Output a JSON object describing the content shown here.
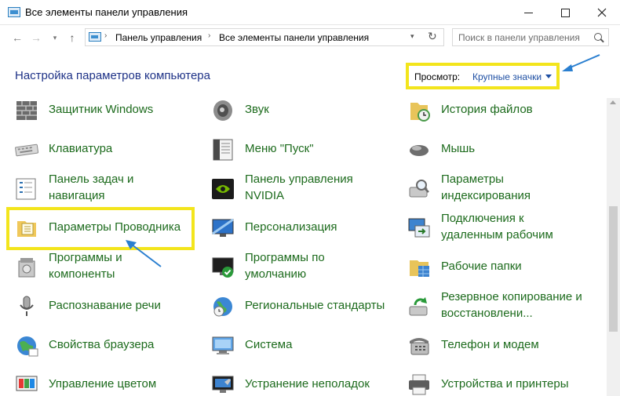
{
  "window": {
    "title": "Все элементы панели управления",
    "minimize": "—",
    "maximize": "☐",
    "close": "✕"
  },
  "nav": {
    "back": "←",
    "forward": "→",
    "recent": "▾",
    "up": "↑",
    "breadcrumbs": [
      "Панель управления",
      "Все элементы панели управления"
    ],
    "separator": "›",
    "dropdown": "▾",
    "refresh": "↻",
    "search_placeholder": "Поиск в панели управления"
  },
  "header": {
    "title": "Настройка параметров компьютера",
    "view_label": "Просмотр:",
    "view_value": "Крупные значки"
  },
  "items": [
    {
      "label": "Защитник Windows",
      "icon": "defender-wall-icon"
    },
    {
      "label": "Звук",
      "icon": "speaker-icon"
    },
    {
      "label": "История файлов",
      "icon": "file-history-icon"
    },
    {
      "label": "Клавиатура",
      "icon": "keyboard-icon"
    },
    {
      "label": "Меню \"Пуск\"",
      "icon": "start-menu-icon"
    },
    {
      "label": "Мышь",
      "icon": "mouse-icon"
    },
    {
      "label": "Панель задач и\nнавигация",
      "icon": "taskbar-icon"
    },
    {
      "label": "Панель управления\nNVIDIA",
      "icon": "nvidia-icon"
    },
    {
      "label": "Параметры\nиндексирования",
      "icon": "indexing-icon"
    },
    {
      "label": "Параметры Проводника",
      "icon": "explorer-options-icon"
    },
    {
      "label": "Персонализация",
      "icon": "personalization-icon"
    },
    {
      "label": "Подключения к\nудаленным рабочим",
      "icon": "remote-desktop-icon"
    },
    {
      "label": "Программы и\nкомпоненты",
      "icon": "programs-icon"
    },
    {
      "label": "Программы по\nумолчанию",
      "icon": "default-programs-icon"
    },
    {
      "label": "Рабочие папки",
      "icon": "work-folders-icon"
    },
    {
      "label": "Распознавание речи",
      "icon": "microphone-icon"
    },
    {
      "label": "Региональные стандарты",
      "icon": "globe-clock-icon"
    },
    {
      "label": "Резервное копирование и\nвосстановлени...",
      "icon": "backup-icon"
    },
    {
      "label": "Свойства браузера",
      "icon": "browser-globe-icon"
    },
    {
      "label": "Система",
      "icon": "system-monitor-icon"
    },
    {
      "label": "Телефон и модем",
      "icon": "phone-icon"
    },
    {
      "label": "Управление цветом",
      "icon": "color-management-icon"
    },
    {
      "label": "Устранение неполадок",
      "icon": "troubleshooting-icon"
    },
    {
      "label": "Устройства и принтеры",
      "icon": "printer-icon"
    }
  ],
  "colors": {
    "link_green": "#1d6b1d",
    "title_blue": "#1e3287",
    "highlight_yellow": "#f3e51c",
    "arrow_blue": "#2a7fd0"
  }
}
